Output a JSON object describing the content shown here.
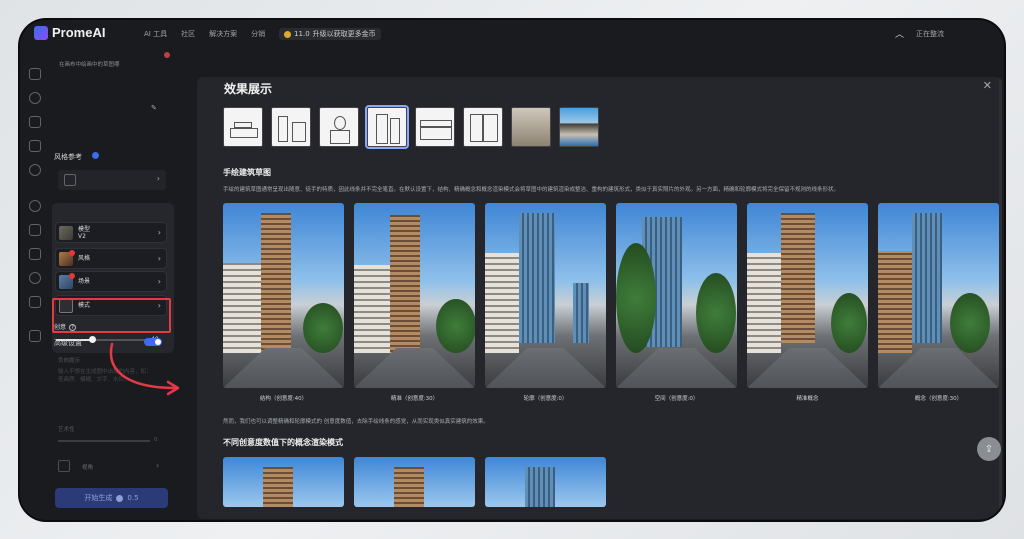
{
  "app": {
    "logo_text": "PromeAI",
    "nav": [
      "AI 工具",
      "社区",
      "解决方案",
      "分销"
    ],
    "promo": {
      "coin_value": "11.0",
      "text": "升级以获取更多金币"
    },
    "top_right": [
      "正在整流"
    ]
  },
  "panel": {
    "prompt_hint": "在画布中绘画中的草图哪",
    "style_ref_label": "风格参考",
    "options_label": "选项",
    "options": [
      {
        "label": "模型",
        "value": "V2"
      },
      {
        "label": "风格",
        "value": ""
      },
      {
        "label": "场景",
        "value": ""
      },
      {
        "label": "模式",
        "value": ""
      }
    ],
    "creativity": {
      "label": "创意",
      "value": 40,
      "min": 0,
      "max": 100,
      "value_text": "40"
    },
    "advanced_label": "高级设置",
    "advanced_enabled": true,
    "negative_label": "负向提示",
    "negative_placeholder": "输入不想在生成图中出现的内容，如：低画质、模糊、文字、水印...",
    "art_label": "艺术性",
    "art_value": "0",
    "camera_label": "视角",
    "generate_label": "开始生成",
    "generate_cost": "0.5"
  },
  "modal": {
    "title": "效果展示",
    "section1_title": "手绘建筑草图",
    "section1_desc": "手绘的建筑草图通常呈现出随意、徒手的特质，因此线条并不完全笔直。在默认设置下，结构、精确概念和概念渲染模式会将草图中的建筑渲染成整洁、重构的建筑形式，类似于真实照片的外观。另一方面，精确和轮廓模式将完全保留不规则的线条形状。",
    "gallery": [
      {
        "caption": "结构（创意度:40）"
      },
      {
        "caption": "精准（创意度:30）"
      },
      {
        "caption": "轮廓（创意度:0）"
      },
      {
        "caption": "空间（创意度:0）"
      },
      {
        "caption": "精准概念"
      },
      {
        "caption": "概念（创意度:30）"
      }
    ],
    "bottom_desc": "然而，我们也可以调整精确和轮廓模式的 创意度数值，去除手绘线条的感觉，从而实现类似真实建筑的效果。",
    "section2_title": "不同创意度数值下的概念渲染模式"
  },
  "colors": {
    "accent": "#3a6df0",
    "highlight": "#e53945",
    "modal_bg": "#24262b",
    "app_bg": "#1a1b1f"
  }
}
